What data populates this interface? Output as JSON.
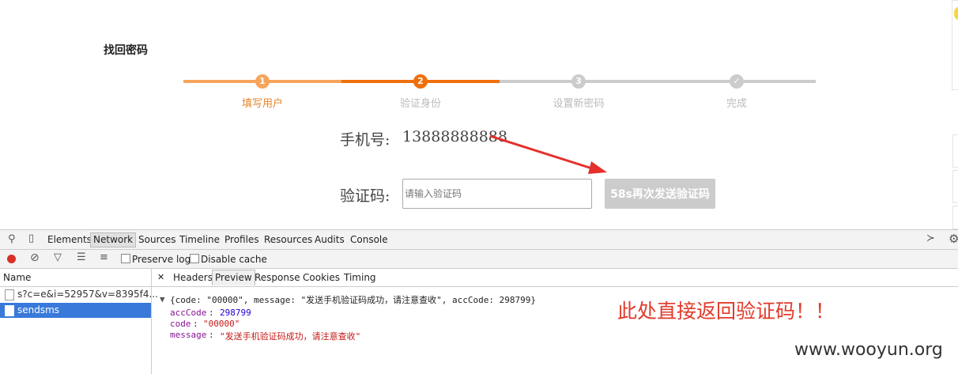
{
  "page": {
    "title": "找回密码",
    "steps": [
      {
        "num": "1",
        "label": "填写用户"
      },
      {
        "num": "2",
        "label": "验证身份"
      },
      {
        "num": "3",
        "label": "设置新密码"
      },
      {
        "num": "✓",
        "label": "完成"
      }
    ],
    "phone_label": "手机号:",
    "phone_value": "13888888888",
    "code_label": "验证码:",
    "code_placeholder": "请输入验证码",
    "resend_button": "58s再次发送验证码"
  },
  "devtools": {
    "tabs": [
      "Elements",
      "Network",
      "Sources",
      "Timeline",
      "Profiles",
      "Resources",
      "Audits",
      "Console"
    ],
    "preserve_log": "Preserve log",
    "disable_cache": "Disable cache",
    "name_header": "Name",
    "requests": [
      "s?c=e&i=52957&v=8395f4...",
      "sendsms"
    ],
    "detail_tabs": [
      "Headers",
      "Preview",
      "Response",
      "Cookies",
      "Timing"
    ],
    "close_symbol": "✕",
    "preview": {
      "summary": "{code: \"00000\", message: \"发送手机验证码成功，请注意查收\", accCode: 298799}",
      "acc_key": "accCode",
      "acc_value": "298799",
      "code_key": "code",
      "code_value": "\"00000\"",
      "message_key": "message",
      "message_value": "\"发送手机验证码成功，请注意查收\""
    }
  },
  "annotation": "此处直接返回验证码！！",
  "watermark": "www.wooyun.org",
  "colors": {
    "step_done": "#f7a45b",
    "step_active": "#f06f0a",
    "step_pending": "#cccccc",
    "annotation_red": "#e23a2a",
    "selected_row": "#3879d9"
  }
}
